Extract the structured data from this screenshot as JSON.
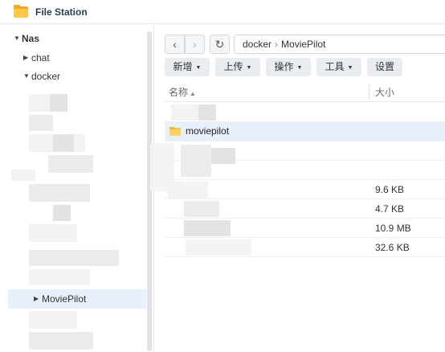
{
  "window": {
    "title": "File Station"
  },
  "sidebar": {
    "root": "Nas",
    "items": [
      {
        "label": "chat"
      },
      {
        "label": "docker"
      }
    ],
    "selected": {
      "label": "MoviePilot"
    }
  },
  "nav": {
    "path": [
      "docker",
      "MoviePilot"
    ],
    "separator": "›"
  },
  "toolbar": {
    "new_label": "新增",
    "upload_label": "上传",
    "action_label": "操作",
    "tools_label": "工具",
    "settings_label": "设置"
  },
  "table": {
    "columns": {
      "name": "名称",
      "size": "大小"
    },
    "rows": [
      {
        "name": "",
        "size": ""
      },
      {
        "name": "moviepilot",
        "size": "",
        "type": "folder",
        "selected": true
      },
      {
        "name": "",
        "size": ""
      },
      {
        "name": "",
        "size": ""
      },
      {
        "name": "",
        "size": "9.6 KB"
      },
      {
        "name": "",
        "size": "4.7 KB"
      },
      {
        "name": "",
        "size": "10.9 MB"
      },
      {
        "name": "",
        "size": "32.6 KB"
      }
    ]
  },
  "colors": {
    "accent": "#e8f1fb",
    "folder": "#f7c24a"
  }
}
